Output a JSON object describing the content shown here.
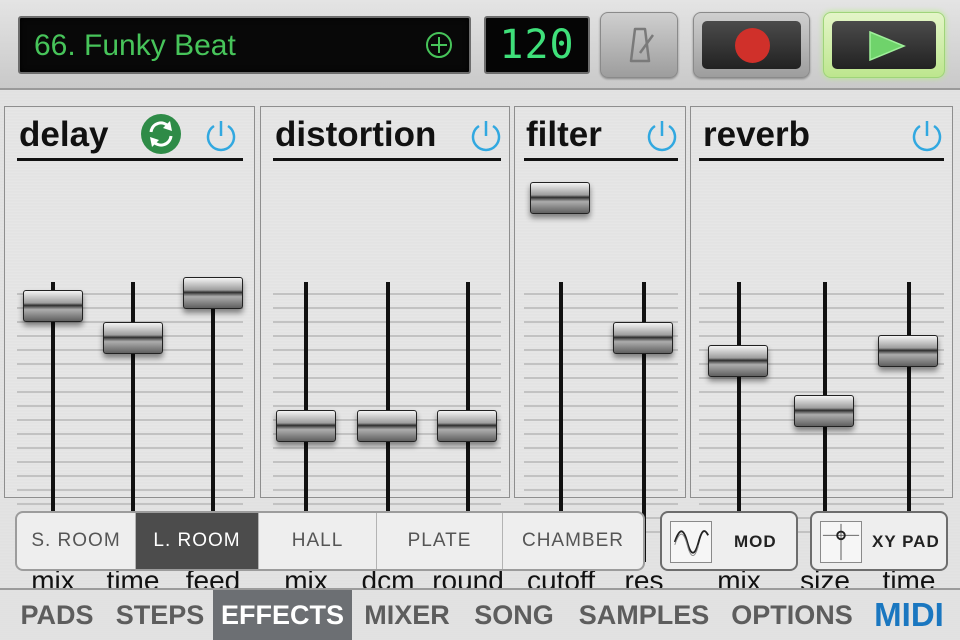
{
  "header": {
    "song_name": "66. Funky Beat",
    "bpm": "120"
  },
  "panels": {
    "delay": {
      "title": "delay",
      "faders": [
        {
          "label": "mix",
          "value": 0.55
        },
        {
          "label": "time",
          "value": 0.42
        },
        {
          "label": "feed",
          "value": 0.6
        }
      ]
    },
    "distortion": {
      "title": "distortion",
      "faders": [
        {
          "label": "mix",
          "value": 0.07
        },
        {
          "label": "dcm",
          "value": 0.07
        },
        {
          "label": "round",
          "value": 0.07
        }
      ]
    },
    "filter": {
      "title": "filter",
      "faders": [
        {
          "label": "cutoff",
          "value": 0.98
        },
        {
          "label": "res",
          "value": 0.42
        }
      ]
    },
    "reverb": {
      "title": "reverb",
      "faders": [
        {
          "label": "mix",
          "value": 0.33
        },
        {
          "label": "size",
          "value": 0.13
        },
        {
          "label": "time",
          "value": 0.37
        }
      ]
    }
  },
  "reverb_types": [
    "S. ROOM",
    "L. ROOM",
    "HALL",
    "PLATE",
    "CHAMBER"
  ],
  "reverb_active": "L. ROOM",
  "mod_label": "MOD",
  "xy_label": "XY PAD",
  "nav": {
    "tabs": [
      "PADS",
      "STEPS",
      "EFFECTS",
      "MIXER",
      "SONG",
      "SAMPLES",
      "OPTIONS"
    ],
    "active": "EFFECTS",
    "midi": "MIDI"
  },
  "colors": {
    "led_green": "#47c45a",
    "power_blue": "#31a8e0",
    "sync_green": "#2e8b47",
    "record_red": "#d0302a"
  }
}
